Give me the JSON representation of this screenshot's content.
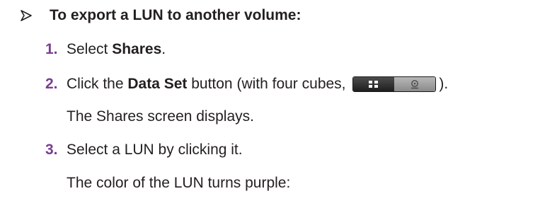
{
  "heading": "To export a LUN to another volume:",
  "steps": [
    {
      "num": "1.",
      "pre": "Select ",
      "bold": "Shares",
      "post": "."
    },
    {
      "num": "2.",
      "pre": "Click the ",
      "bold": "Data Set",
      "mid": " button (with four cubes, ",
      "post": ")."
    },
    {
      "num": "3.",
      "pre": "Select a LUN by clicking it."
    }
  ],
  "notes": [
    "The Shares screen displays.",
    "The color of the LUN turns purple:"
  ],
  "icons": {
    "heading_marker": "arrow-right-icon",
    "dataset_button": "data-set-toggle-icon"
  },
  "colors": {
    "step_number": "#7a3d8f",
    "text": "#231f20"
  }
}
